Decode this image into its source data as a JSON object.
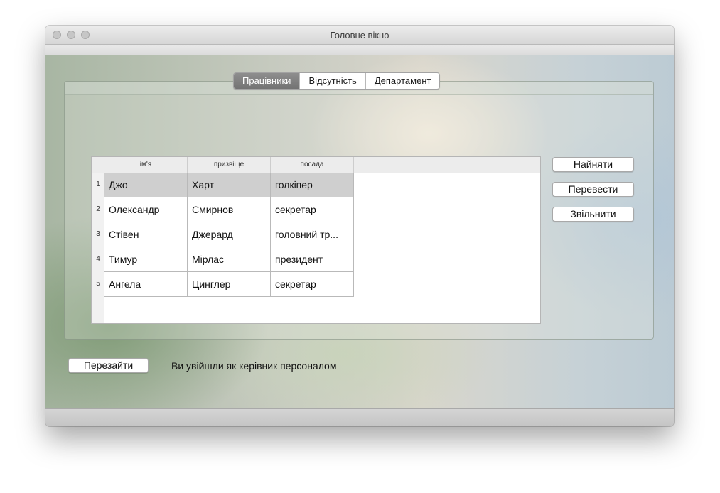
{
  "window": {
    "title": "Головне вікно"
  },
  "tabs": [
    {
      "label": "Працівники",
      "active": true
    },
    {
      "label": "Відсутність",
      "active": false
    },
    {
      "label": "Департамент",
      "active": false
    }
  ],
  "table": {
    "columns": [
      "ім'я",
      "призвіще",
      "посада"
    ],
    "rows": [
      {
        "num": "1",
        "name": "Джо",
        "surname": "Харт",
        "position": "голкіпер",
        "selected": true
      },
      {
        "num": "2",
        "name": "Олександр",
        "surname": "Смирнов",
        "position": "секретар",
        "selected": false
      },
      {
        "num": "3",
        "name": "Стівен",
        "surname": "Джерард",
        "position": "головний тр...",
        "selected": false
      },
      {
        "num": "4",
        "name": "Тимур",
        "surname": "Мірлас",
        "position": "президент",
        "selected": false
      },
      {
        "num": "5",
        "name": "Ангела",
        "surname": "Цинглер",
        "position": "секретар",
        "selected": false
      }
    ]
  },
  "actions": {
    "hire": "Найняти",
    "transfer": "Перевести",
    "fire": "Звільнити"
  },
  "footer": {
    "relogin": "Перезайти",
    "status": "Ви увійшли як керівник персоналом"
  },
  "colors": {
    "active_tab": "#808080",
    "selected_row": "#cfcfcf"
  }
}
